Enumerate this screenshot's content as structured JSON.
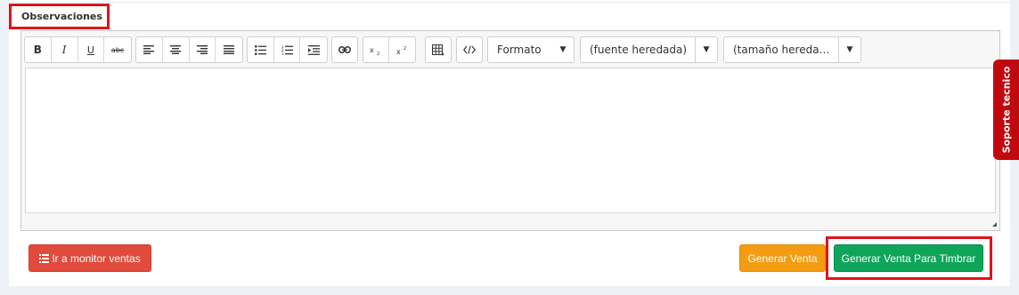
{
  "field": {
    "label": "Observaciones"
  },
  "toolbar": {
    "bold": "B",
    "italic": "I",
    "underline": "U",
    "strike": "abc",
    "formato": "Formato",
    "font": "(fuente heredada)",
    "size": "(tamaño hereda…"
  },
  "icons": {
    "bold": "bold-icon",
    "italic": "italic-icon",
    "underline": "underline-icon",
    "strike": "strikethrough-icon",
    "align_left": "align-left-icon",
    "align_center": "align-center-icon",
    "align_right": "align-right-icon",
    "justify": "align-justify-icon",
    "ul": "unordered-list-icon",
    "ol": "ordered-list-icon",
    "indent": "indent-icon",
    "link": "link-icon",
    "sub": "subscript-icon",
    "sup": "superscript-icon",
    "table": "table-icon",
    "code": "code-icon",
    "monitor": "list-icon"
  },
  "actions": {
    "monitor": "Ir a monitor ventas",
    "generar": "Generar Venta",
    "timbrar": "Generar Venta Para Timbrar"
  },
  "support": {
    "label": "Soporte tecnico"
  },
  "colors": {
    "red_button": "#e14b3b",
    "orange_button": "#f39c12",
    "green_button": "#0ea55a",
    "support_tab": "#c1080f",
    "highlight": "#e0131b"
  }
}
